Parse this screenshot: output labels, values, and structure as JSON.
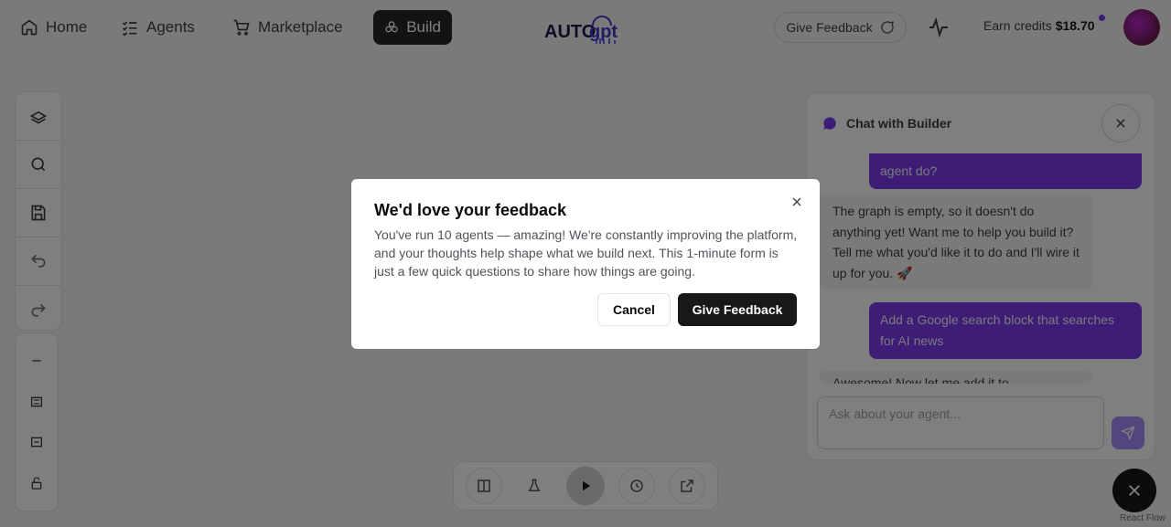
{
  "nav": {
    "home": "Home",
    "agents": "Agents",
    "marketplace": "Marketplace",
    "build": "Build",
    "feedback": "Give Feedback",
    "credits_label": "Earn credits",
    "credits_value": "$18.70"
  },
  "toolbar": {
    "icons": [
      "blocks-icon",
      "search-icon",
      "save-icon",
      "undo-icon",
      "redo-icon"
    ],
    "secondary_icons": [
      "minus-icon",
      "fit-view-icon",
      "fullscreen-icon",
      "lock-icon"
    ]
  },
  "chat": {
    "title": "Chat with Builder",
    "messages": [
      {
        "role": "user",
        "text": "agent do?"
      },
      {
        "role": "assistant",
        "text": "The graph is empty, so it doesn't do anything yet! Want me to help you build it? Tell me what you'd like it to do and I'll wire it up for you. 🚀"
      },
      {
        "role": "user",
        "text": "Add a Google search block that searches for AI news"
      },
      {
        "role": "assistant",
        "text": "Awesome! Now let me add it to..."
      }
    ],
    "input_placeholder": "Ask about your agent..."
  },
  "dialog": {
    "title": "We'd love your feedback",
    "body": "You've run 10 agents — amazing! We're constantly improving the platform, and your thoughts help shape what we build next. This 1-minute form is just a few quick questions to share how things are going.",
    "cancel": "Cancel",
    "confirm": "Give Feedback"
  },
  "footer": {
    "react_flow": "React Flow"
  },
  "colors": {
    "accent": "#7c3aed",
    "dark": "#18181b",
    "overlay": "rgba(0,0,0,0.5)"
  }
}
